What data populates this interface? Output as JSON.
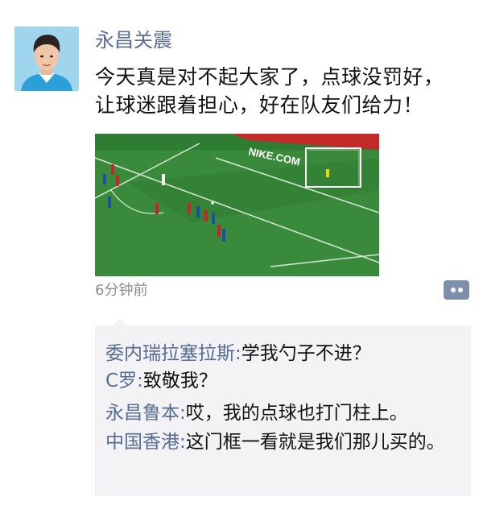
{
  "post": {
    "user_name": "永昌关震",
    "text": "今天真是对不起大家了，点球没罚好，让球迷跟着担心，好在队友们给力！",
    "time": "6分钟前",
    "photo": {
      "banner_text": "NIKE.COM",
      "accent_colors": {
        "pitch": "#2f7d33",
        "banner": "#c42a2a",
        "red_kit": "#c0282d",
        "blue_kit": "#1d4fa3",
        "white_kit": "#f2f2f2"
      }
    }
  },
  "comments": [
    {
      "user": "委内瑞拉塞拉斯",
      "sep": ":",
      "text": "学我勺子不进？"
    },
    {
      "user": "C罗",
      "sep": ":",
      "text": "致敬我？"
    },
    {
      "user": "永昌鲁本",
      "sep": ":",
      "text": "哎，我的点球也打门柱上。"
    },
    {
      "user": "中国香港",
      "sep": ":",
      "text": "这门框一看就是我们那儿买的。"
    }
  ],
  "icons": {
    "comment_button": "comment-dots-icon"
  },
  "colors": {
    "name_link": "#576b95",
    "timestamp": "#8c8c8c",
    "comment_bg": "#f3f3f5",
    "comment_button": "#7d8fab"
  }
}
